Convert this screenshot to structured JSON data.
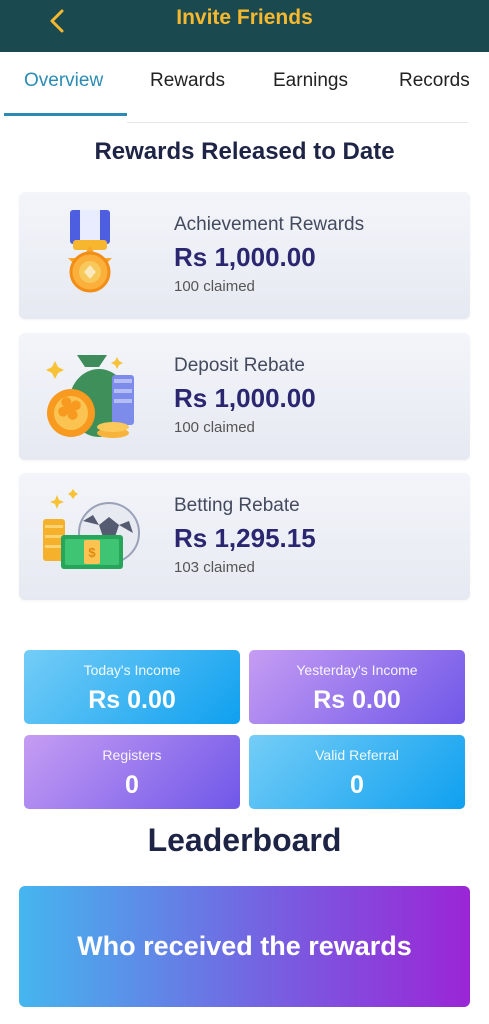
{
  "header": {
    "title": "Invite Friends"
  },
  "tabs": [
    {
      "label": "Overview"
    },
    {
      "label": "Rewards"
    },
    {
      "label": "Earnings"
    },
    {
      "label": "Records"
    }
  ],
  "section_title": "Rewards Released to Date",
  "reward_cards": [
    {
      "name": "Achievement Rewards",
      "amount": "Rs 1,000.00",
      "claimed": "100 claimed",
      "icon": "medal-icon"
    },
    {
      "name": "Deposit Rebate",
      "amount": "Rs 1,000.00",
      "claimed": "100 claimed",
      "icon": "money-bag-icon"
    },
    {
      "name": "Betting Rebate",
      "amount": "Rs 1,295.15",
      "claimed": "103 claimed",
      "icon": "football-cash-icon"
    }
  ],
  "stats": [
    {
      "label": "Today's Income",
      "value": "Rs 0.00"
    },
    {
      "label": "Yesterday's Income",
      "value": "Rs 0.00"
    },
    {
      "label": "Registers",
      "value": "0"
    },
    {
      "label": "Valid Referral",
      "value": "0"
    }
  ],
  "leaderboard": {
    "title": "Leaderboard",
    "banner": "Who received the rewards"
  },
  "colors": {
    "header_bg": "#1a4a4f",
    "title_accent": "#f5b82e",
    "tab_active": "#2b8bb5",
    "amount": "#2a2670"
  }
}
